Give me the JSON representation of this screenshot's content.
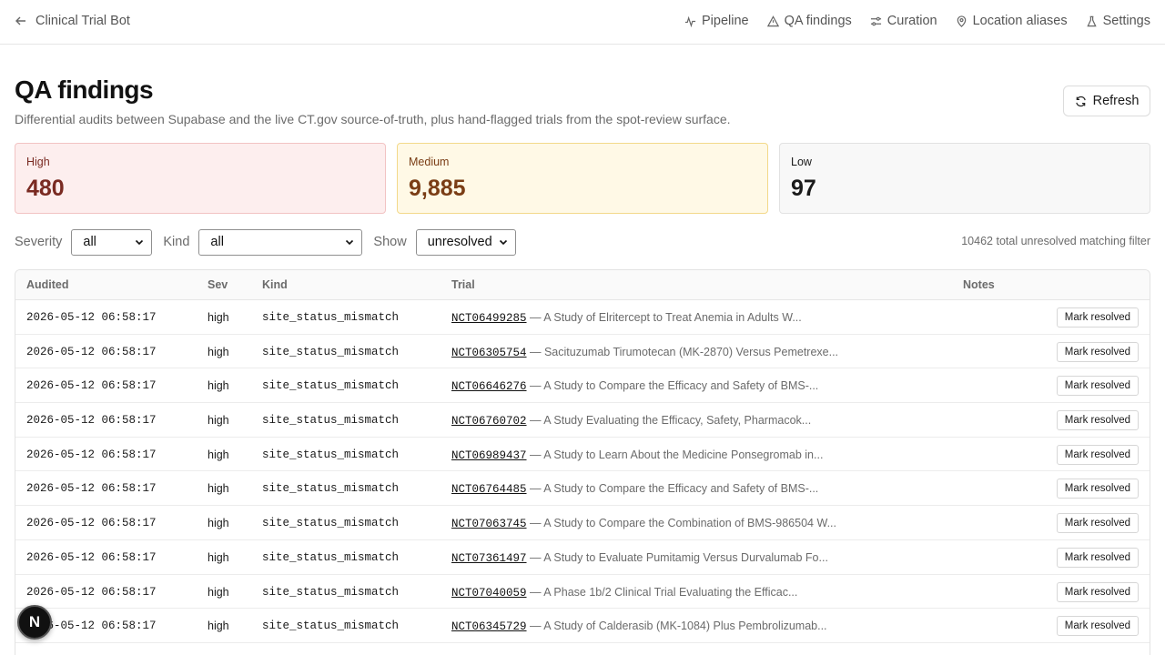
{
  "app": {
    "back_label": "Clinical Trial Bot"
  },
  "nav": [
    {
      "label": "Pipeline",
      "icon": "activity-icon"
    },
    {
      "label": "QA findings",
      "icon": "alert-triangle-icon"
    },
    {
      "label": "Curation",
      "icon": "sliders-icon"
    },
    {
      "label": "Location aliases",
      "icon": "map-pin-icon"
    },
    {
      "label": "Settings",
      "icon": "flask-icon"
    }
  ],
  "header": {
    "title": "QA findings",
    "subtitle": "Differential audits between Supabase and the live CT.gov source-of-truth, plus hand-flagged trials from the spot-review surface.",
    "refresh_label": "Refresh"
  },
  "cards": {
    "high": {
      "label": "High",
      "value": "480"
    },
    "medium": {
      "label": "Medium",
      "value": "9,885"
    },
    "low": {
      "label": "Low",
      "value": "97"
    }
  },
  "filters": {
    "severity_label": "Severity",
    "severity_value": "all",
    "kind_label": "Kind",
    "kind_value": "all",
    "show_label": "Show",
    "show_value": "unresolved",
    "total_text": "10462 total unresolved matching filter"
  },
  "table": {
    "columns": [
      "Audited",
      "Sev",
      "Kind",
      "Trial",
      "Notes"
    ],
    "action_label": "Mark resolved",
    "rows": [
      {
        "audited": "2026-05-12 06:58:17",
        "sev": "high",
        "kind": "site_status_mismatch",
        "nct": "NCT06499285",
        "title": "— A Study of Elritercept to Treat Anemia in Adults W..."
      },
      {
        "audited": "2026-05-12 06:58:17",
        "sev": "high",
        "kind": "site_status_mismatch",
        "nct": "NCT06305754",
        "title": "— Sacituzumab Tirumotecan (MK-2870) Versus Pemetrexe..."
      },
      {
        "audited": "2026-05-12 06:58:17",
        "sev": "high",
        "kind": "site_status_mismatch",
        "nct": "NCT06646276",
        "title": "— A Study to Compare the Efficacy and Safety of BMS-..."
      },
      {
        "audited": "2026-05-12 06:58:17",
        "sev": "high",
        "kind": "site_status_mismatch",
        "nct": "NCT06760702",
        "title": "— A Study Evaluating the Efficacy, Safety, Pharmacok..."
      },
      {
        "audited": "2026-05-12 06:58:17",
        "sev": "high",
        "kind": "site_status_mismatch",
        "nct": "NCT06989437",
        "title": "— A Study to Learn About the Medicine Ponsegromab in..."
      },
      {
        "audited": "2026-05-12 06:58:17",
        "sev": "high",
        "kind": "site_status_mismatch",
        "nct": "NCT06764485",
        "title": "— A Study to Compare the Efficacy and Safety of BMS-..."
      },
      {
        "audited": "2026-05-12 06:58:17",
        "sev": "high",
        "kind": "site_status_mismatch",
        "nct": "NCT07063745",
        "title": "— A Study to Compare the Combination of BMS-986504 W..."
      },
      {
        "audited": "2026-05-12 06:58:17",
        "sev": "high",
        "kind": "site_status_mismatch",
        "nct": "NCT07361497",
        "title": "— A Study to Evaluate Pumitamig Versus Durvalumab Fo..."
      },
      {
        "audited": "2026-05-12 06:58:17",
        "sev": "high",
        "kind": "site_status_mismatch",
        "nct": "NCT07040059",
        "title": "— A Phase 1b/2 Clinical Trial Evaluating the Efficac..."
      },
      {
        "audited": "2026-05-12 06:58:17",
        "sev": "high",
        "kind": "site_status_mismatch",
        "nct": "NCT06345729",
        "title": "— A Study of Calderasib (MK-1084) Plus Pembrolizumab..."
      }
    ]
  },
  "badge": {
    "letter": "N"
  }
}
